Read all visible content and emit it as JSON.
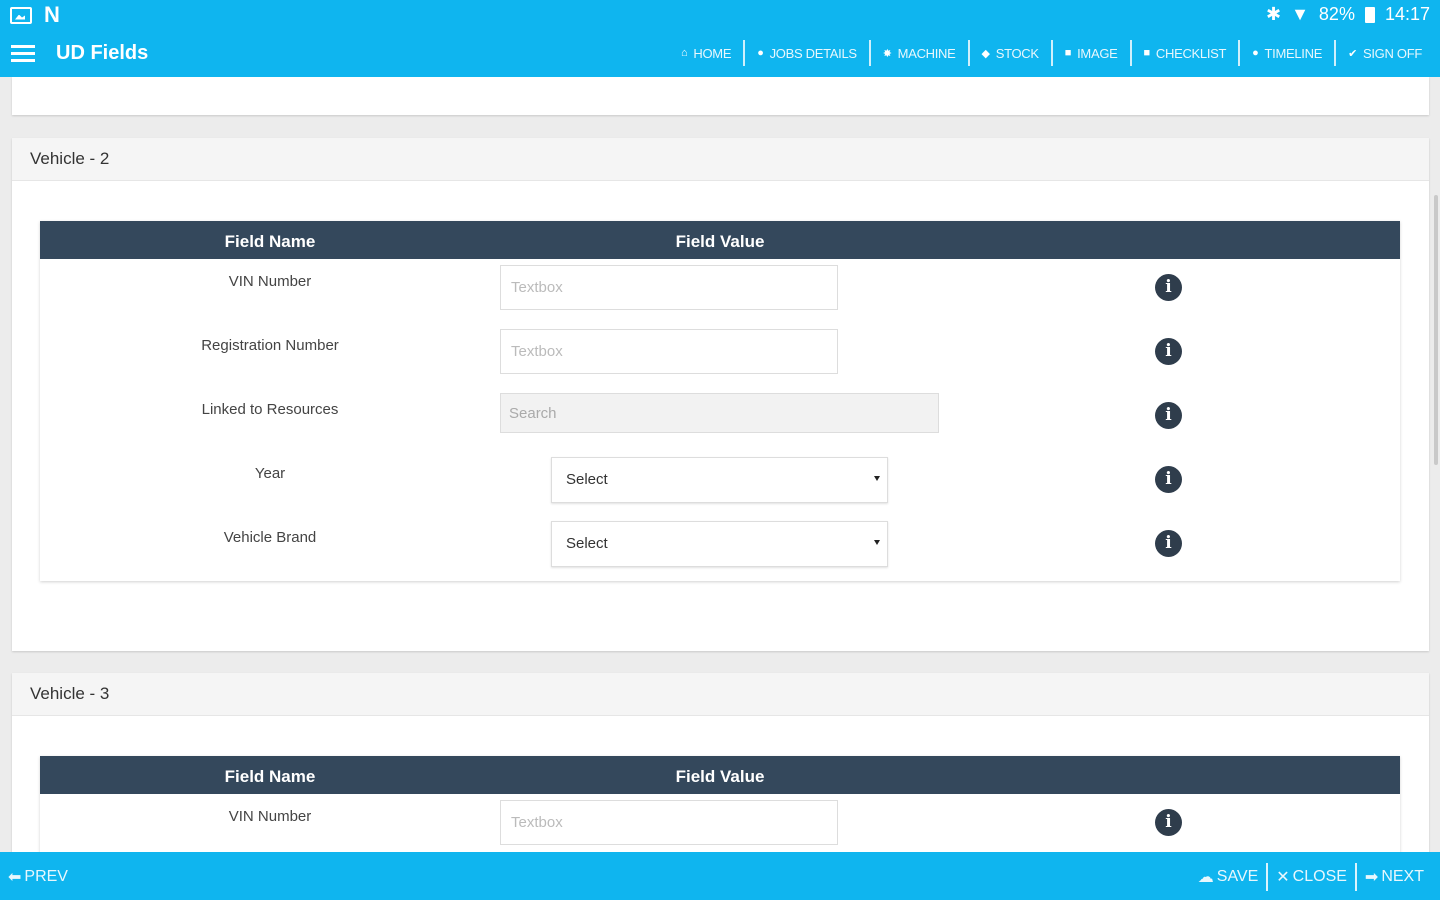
{
  "status_bar": {
    "battery": "82%",
    "time": "14:17"
  },
  "app_bar": {
    "title": "UD Fields",
    "nav": [
      {
        "label": "HOME",
        "icon": "home-icon"
      },
      {
        "label": "JOBS DETAILS",
        "icon": "circle-icon"
      },
      {
        "label": "MACHINE",
        "icon": "star-icon"
      },
      {
        "label": "STOCK",
        "icon": "tag-icon"
      },
      {
        "label": "IMAGE",
        "icon": "image-icon"
      },
      {
        "label": "CHECKLIST",
        "icon": "square-icon"
      },
      {
        "label": "TIMELINE",
        "icon": "circle-icon"
      },
      {
        "label": "SIGN OFF",
        "icon": "check-icon"
      }
    ]
  },
  "table_headers": {
    "field_name": "Field Name",
    "field_value": "Field Value"
  },
  "vehicle2": {
    "title": "Vehicle - 2",
    "rows": [
      {
        "label": "VIN Number",
        "placeholder": "Textbox"
      },
      {
        "label": "Registration Number",
        "placeholder": "Textbox"
      },
      {
        "label": "Linked to Resources",
        "placeholder": "Search"
      },
      {
        "label": "Year",
        "value": "Select"
      },
      {
        "label": "Vehicle Brand",
        "value": "Select"
      }
    ]
  },
  "vehicle3": {
    "title": "Vehicle - 3",
    "rows": [
      {
        "label": "VIN Number",
        "placeholder": "Textbox"
      }
    ]
  },
  "bottom_bar": {
    "prev": "PREV",
    "save": "SAVE",
    "close": "CLOSE",
    "next": "NEXT"
  },
  "colors": {
    "primary": "#0fb5ef",
    "table_header": "#34485c",
    "info_icon": "#2f3d4c"
  }
}
